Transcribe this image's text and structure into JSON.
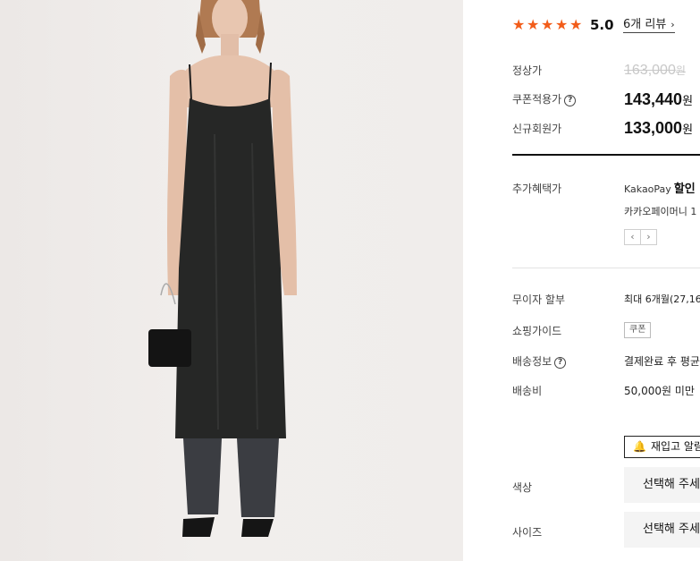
{
  "product": {
    "image_alt": "model wearing black slip dress"
  },
  "rating": {
    "star_icons": [
      "★",
      "★",
      "★",
      "★",
      "★"
    ],
    "score": "5.0",
    "review_link": "6개 리뷰",
    "review_chevron": "›",
    "star_color": "#f25c19"
  },
  "prices": {
    "regular_label": "정상가",
    "regular_value": "163,000",
    "regular_unit": "원",
    "coupon_label": "쿠폰적용가",
    "coupon_help": "?",
    "coupon_value": "143,440",
    "coupon_unit": "원",
    "member_label": "신규회원가",
    "member_value": "133,000",
    "member_unit": "원"
  },
  "benefit": {
    "label": "추가혜택가",
    "kakao_brand": "KakaoPay",
    "kakao_discount": "할인",
    "kakao_sub": "카카오페이머니 1",
    "prev": "‹",
    "next": "›"
  },
  "info": {
    "installment_label": "무이자 할부",
    "installment_value": "최대 6개월(27,16",
    "guide_label": "쇼핑가이드",
    "guide_tag": "쿠폰",
    "shipping_label": "배송정보",
    "shipping_help": "?",
    "shipping_value": "결제완료 후 평균",
    "fee_label": "배송비",
    "fee_value": "50,000원 미만"
  },
  "options": {
    "restock_icon": "🔔",
    "restock_label": "재입고 알림",
    "color_label": "색상",
    "color_placeholder": "선택해 주세",
    "size_label": "사이즈",
    "size_placeholder": "선택해 주세"
  }
}
